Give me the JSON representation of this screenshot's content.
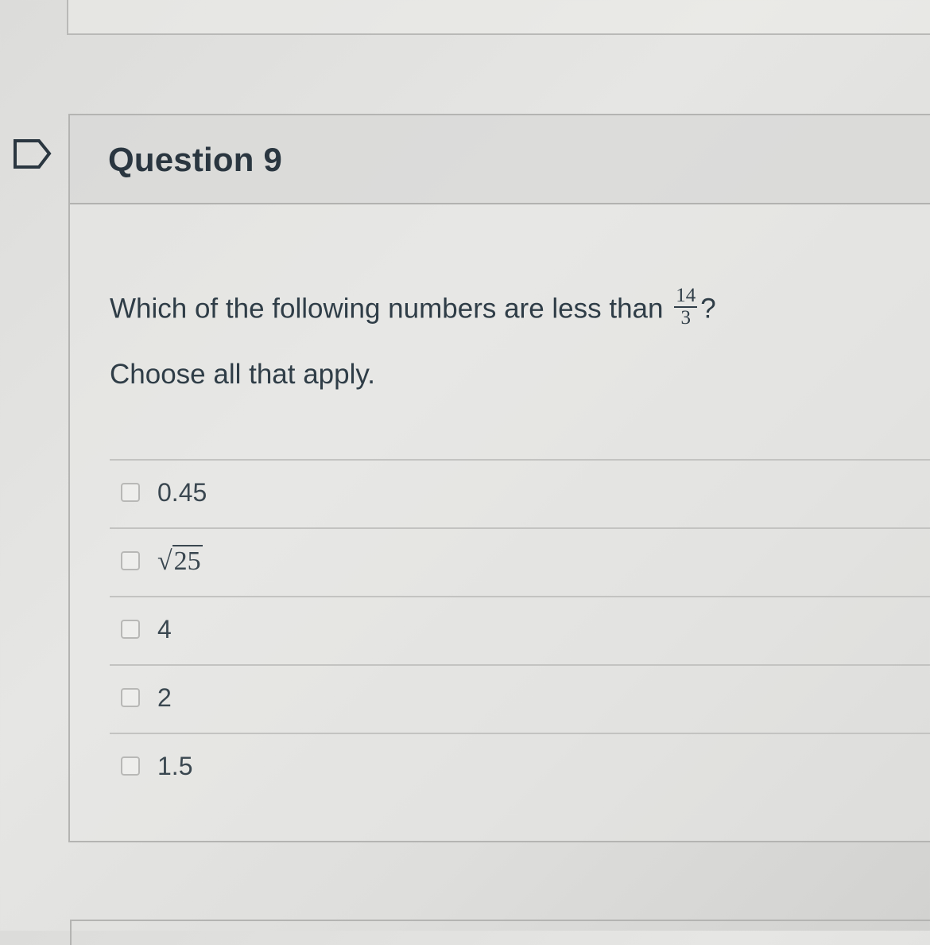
{
  "question": {
    "title": "Question 9",
    "prompt_text": "Which of the following numbers are less than",
    "fraction_numerator": "14",
    "fraction_denominator": "3",
    "prompt_suffix": "?",
    "instruction": "Choose all that apply."
  },
  "answers": [
    {
      "label": "0.45",
      "checked": false
    },
    {
      "label": "25",
      "type": "sqrt",
      "checked": false
    },
    {
      "label": "4",
      "checked": false
    },
    {
      "label": "2",
      "checked": false
    },
    {
      "label": "1.5",
      "checked": false
    }
  ],
  "icons": {
    "flag": "bookmark-flag-icon",
    "checkbox": "checkbox-icon",
    "sqrt": "square-root-symbol"
  },
  "sqrt_symbol": "√",
  "colors": {
    "text": "#2f3d47",
    "border": "#b4b4b2",
    "header_bg": "#d6d6d4"
  }
}
